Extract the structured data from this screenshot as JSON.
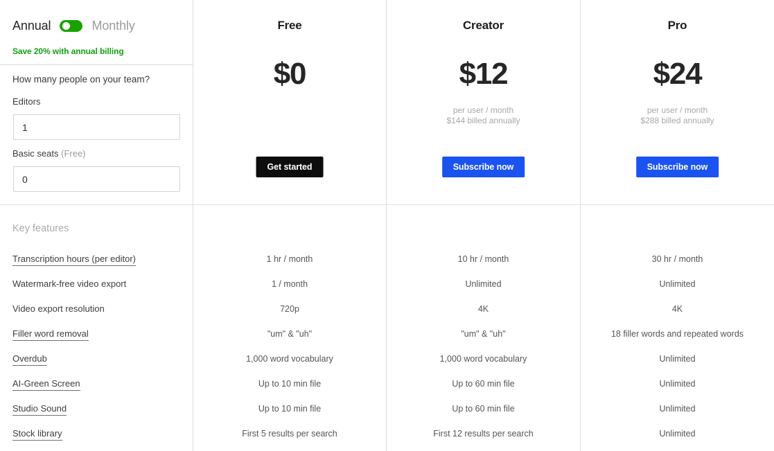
{
  "billing": {
    "annual_label": "Annual",
    "monthly_label": "Monthly",
    "selected": "Annual",
    "toggle_color": "#18a300",
    "save_note": "Save 20% with annual billing",
    "save_note_color": "#14a014"
  },
  "team_form": {
    "question": "How many people on your team?",
    "editors_label": "Editors",
    "editors_value": "1",
    "basic_label": "Basic seats",
    "basic_label_muted": "(Free)",
    "basic_value": "0"
  },
  "features_header": "Key features",
  "features": [
    {
      "label": "Transcription hours (per editor)",
      "is_link": true
    },
    {
      "label": "Watermark-free video export",
      "is_link": false
    },
    {
      "label": "Video export resolution",
      "is_link": false
    },
    {
      "label": "Filler word removal",
      "is_link": true
    },
    {
      "label": "Overdub",
      "is_link": true
    },
    {
      "label": "AI-Green Screen",
      "is_link": true
    },
    {
      "label": "Studio Sound",
      "is_link": true
    },
    {
      "label": "Stock library",
      "is_link": true
    }
  ],
  "plans": [
    {
      "name": "Free",
      "price": "$0",
      "sub_line1": "",
      "sub_line2": "",
      "cta_label": "Get started",
      "cta_style": "dark",
      "cta_color": "#0d0d0d",
      "values": [
        "1 hr / month",
        "1 / month",
        "720p",
        "\"um\" & \"uh\"",
        "1,000 word vocabulary",
        "Up to 10 min file",
        "Up to 10 min file",
        "First 5 results per search"
      ]
    },
    {
      "name": "Creator",
      "price": "$12",
      "sub_line1": "per user / month",
      "sub_line2": "$144 billed annually",
      "cta_label": "Subscribe now",
      "cta_style": "blue",
      "cta_color": "#1a53f0",
      "values": [
        "10 hr / month",
        "Unlimited",
        "4K",
        "\"um\" & \"uh\"",
        "1,000 word vocabulary",
        "Up to 60 min file",
        "Up to 60 min file",
        "First 12 results per search"
      ]
    },
    {
      "name": "Pro",
      "price": "$24",
      "sub_line1": "per user / month",
      "sub_line2": "$288 billed annually",
      "cta_label": "Subscribe now",
      "cta_style": "blue",
      "cta_color": "#1a53f0",
      "values": [
        "30 hr / month",
        "Unlimited",
        "4K",
        "18 filler words and repeated words",
        "Unlimited",
        "Unlimited",
        "Unlimited",
        "Unlimited"
      ]
    }
  ]
}
